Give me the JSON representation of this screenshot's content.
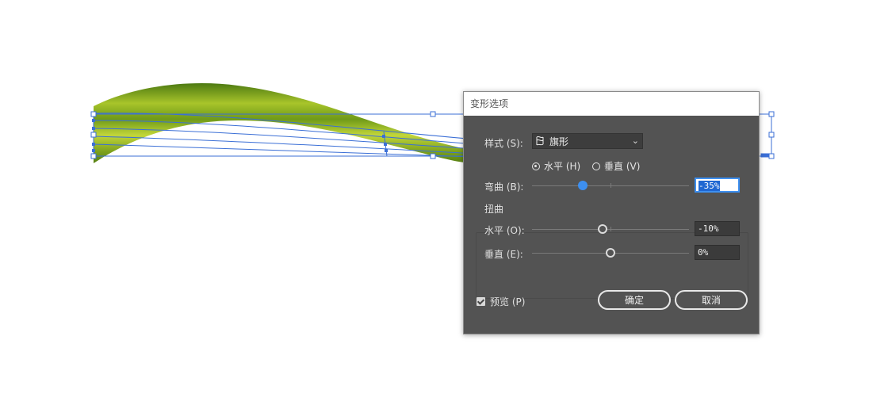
{
  "dialog": {
    "title": "变形选项",
    "style_label": "样式 (S):",
    "style_value": "旗形",
    "orientation": {
      "horizontal_label": "水平 (H)",
      "vertical_label": "垂直 (V)",
      "selected": "horizontal"
    },
    "bend": {
      "label": "弯曲 (B):",
      "value": "-35%",
      "level": -35
    },
    "distortion": {
      "group_label": "扭曲",
      "horizontal": {
        "label": "水平 (O):",
        "value": "-10%",
        "level": -10
      },
      "vertical": {
        "label": "垂直 (E):",
        "value": "0%",
        "level": 0
      }
    },
    "preview": {
      "label": "预览 (P)",
      "checked": true
    },
    "ok_label": "确定",
    "cancel_label": "取消"
  },
  "colors": {
    "dialog_bg": "#535353",
    "accent": "#3d8ff0",
    "selection": "#3b6fd6",
    "leaf_dark": "#4d7a12",
    "leaf_light": "#b5cc2e"
  }
}
